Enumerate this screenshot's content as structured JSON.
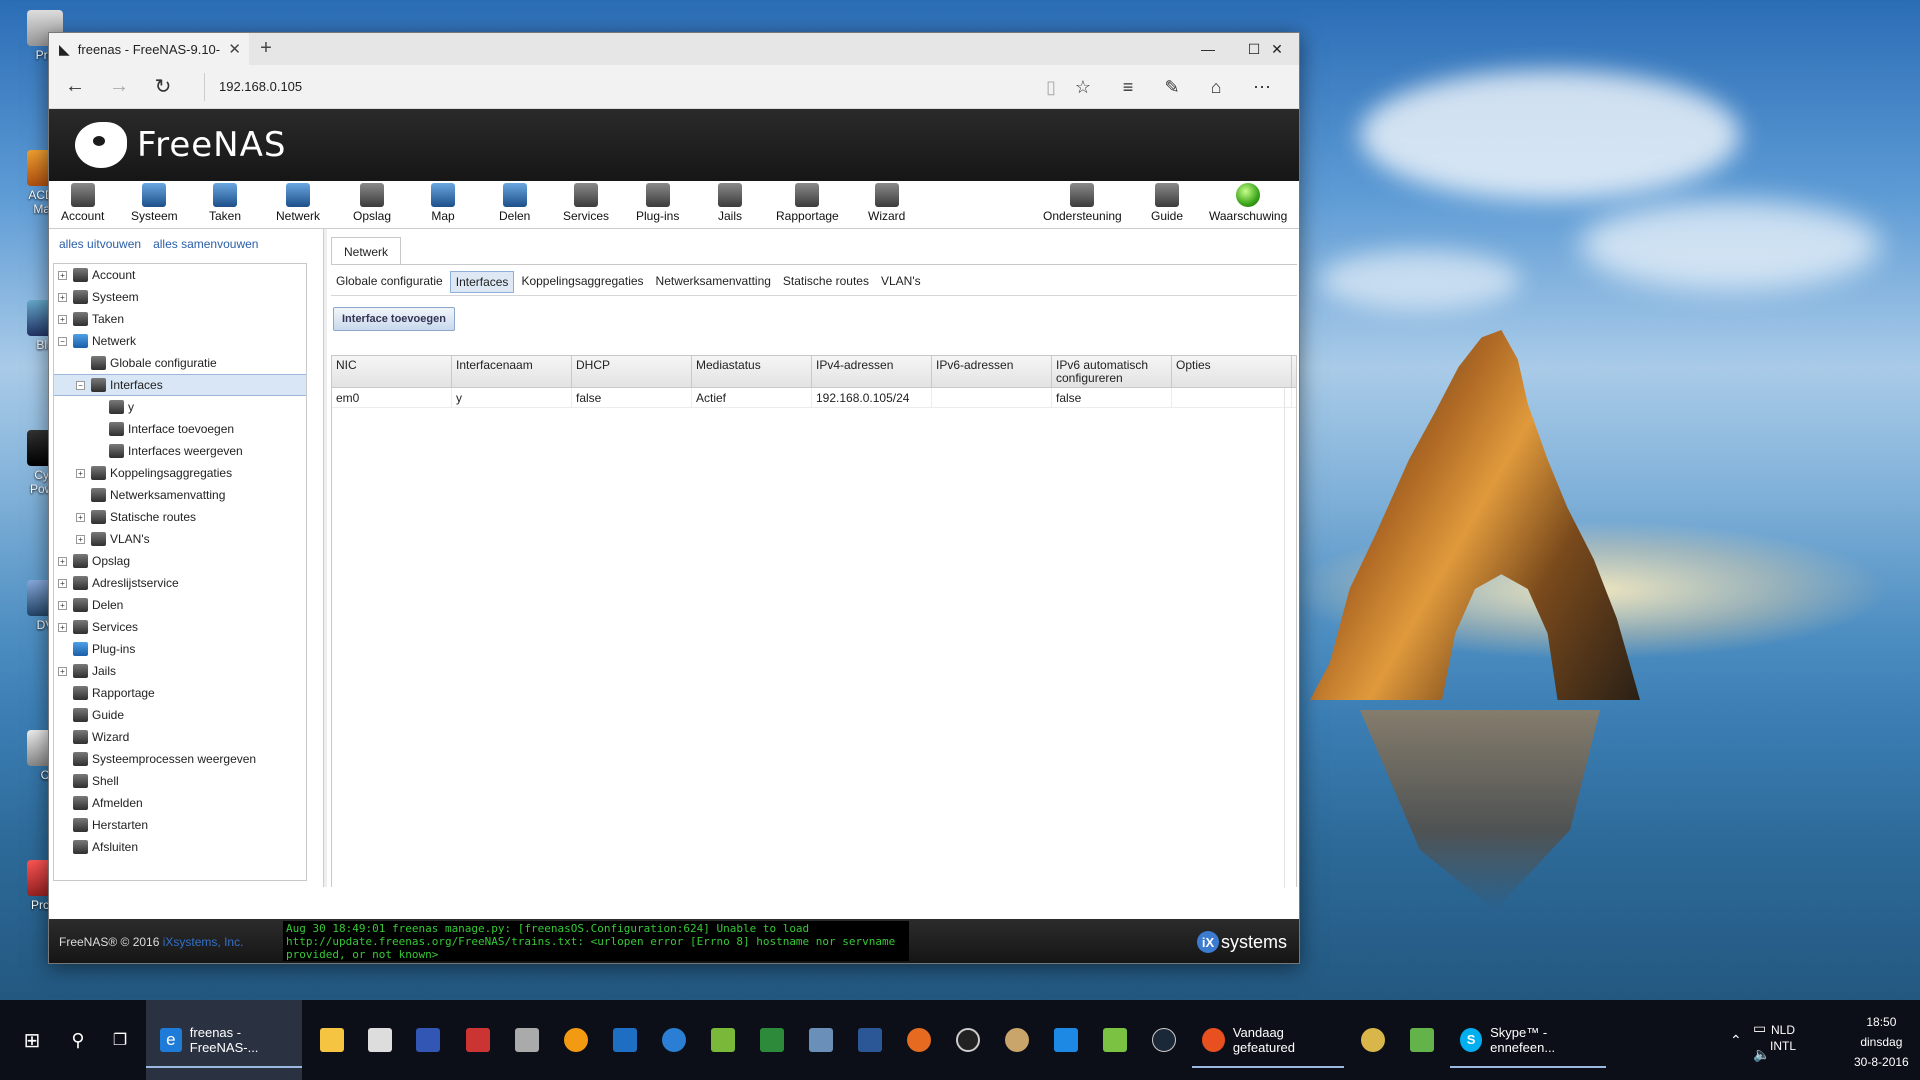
{
  "desktop": {
    "icons": [
      "Pru",
      "ACDS Man",
      "Blu",
      "Cyb Powe",
      "DV",
      "C",
      "Proje"
    ]
  },
  "browser": {
    "tab_title": "freenas - FreeNAS-9.10-",
    "tab_close": "✕",
    "new_tab": "+",
    "url": "192.168.0.105",
    "window_controls": {
      "minimize": "—",
      "maximize": "☐",
      "close": "✕"
    },
    "nav": {
      "back": "←",
      "forward": "→",
      "refresh": "↻"
    },
    "toolbar_icons": [
      "reading-view",
      "favorite",
      "hub",
      "web-note",
      "share",
      "more"
    ]
  },
  "freenas": {
    "logo_text": "FreeNAS",
    "toolbar": [
      {
        "label": "Account"
      },
      {
        "label": "Systeem"
      },
      {
        "label": "Taken"
      },
      {
        "label": "Netwerk"
      },
      {
        "label": "Opslag"
      },
      {
        "label": "Map"
      },
      {
        "label": "Delen"
      },
      {
        "label": "Services"
      },
      {
        "label": "Plug-ins"
      },
      {
        "label": "Jails"
      },
      {
        "label": "Rapportage"
      },
      {
        "label": "Wizard"
      },
      {
        "label": "Ondersteuning"
      },
      {
        "label": "Guide"
      },
      {
        "label": "Waarschuwing"
      }
    ],
    "left": {
      "expand_all": "alles uitvouwen",
      "collapse_all": "alles samenvouwen",
      "tree": [
        {
          "label": "Account",
          "exp": "+"
        },
        {
          "label": "Systeem",
          "exp": "+"
        },
        {
          "label": "Taken",
          "exp": "+"
        },
        {
          "label": "Netwerk",
          "exp": "−"
        },
        {
          "label": "Globale configuratie",
          "exp": ""
        },
        {
          "label": "Interfaces",
          "exp": "−"
        },
        {
          "label": "y",
          "exp": ""
        },
        {
          "label": "Interface toevoegen",
          "exp": ""
        },
        {
          "label": "Interfaces weergeven",
          "exp": ""
        },
        {
          "label": "Koppelingsaggregaties",
          "exp": "+"
        },
        {
          "label": "Netwerksamenvatting",
          "exp": ""
        },
        {
          "label": "Statische routes",
          "exp": "+"
        },
        {
          "label": "VLAN's",
          "exp": "+"
        },
        {
          "label": "Opslag",
          "exp": "+"
        },
        {
          "label": "Adreslijstservice",
          "exp": "+"
        },
        {
          "label": "Delen",
          "exp": "+"
        },
        {
          "label": "Services",
          "exp": "+"
        },
        {
          "label": "Plug-ins",
          "exp": ""
        },
        {
          "label": "Jails",
          "exp": "+"
        },
        {
          "label": "Rapportage",
          "exp": ""
        },
        {
          "label": "Guide",
          "exp": ""
        },
        {
          "label": "Wizard",
          "exp": ""
        },
        {
          "label": "Systeemprocessen weergeven",
          "exp": ""
        },
        {
          "label": "Shell",
          "exp": ""
        },
        {
          "label": "Afmelden",
          "exp": ""
        },
        {
          "label": "Herstarten",
          "exp": ""
        },
        {
          "label": "Afsluiten",
          "exp": ""
        }
      ]
    },
    "content": {
      "main_tab": "Netwerk",
      "subtabs": [
        "Globale configuratie",
        "Interfaces",
        "Koppelingsaggregaties",
        "Netwerksamenvatting",
        "Statische routes",
        "VLAN's"
      ],
      "active_subtab": "Interfaces",
      "add_button": "Interface toevoegen",
      "columns": [
        "NIC",
        "Interfacenaam",
        "DHCP",
        "Mediastatus",
        "IPv4-adressen",
        "IPv6-adressen",
        "IPv6 automatisch configureren",
        "Opties"
      ],
      "rows": [
        [
          "em0",
          "y",
          "false",
          "Actief",
          "192.168.0.105/24",
          "",
          "false",
          ""
        ]
      ]
    },
    "footer": {
      "copyright": "FreeNAS® © 2016",
      "company": "iXsystems, Inc.",
      "console": "Aug 30 18:49:01 freenas manage.py: [freenasOS.Configuration:624] Unable to load http://update.freenas.org/FreeNAS/trains.txt: <urlopen error [Errno 8] hostname nor servname provided, or not known>",
      "ix_badge": "iX",
      "ix_text": "systems"
    }
  },
  "taskbar": {
    "edge_task": "freenas - FreeNAS-...",
    "vandaag": "Vandaag gefeatured",
    "skype": "Skype™ - ennefeen...",
    "lang_top": "NLD",
    "lang_bottom": "INTL",
    "time": "18:50",
    "day": "dinsdag",
    "date": "30-8-2016"
  },
  "colors": {
    "accent": "#2a5ea8",
    "console_text": "#37c837",
    "selection": "#d8e6f5"
  }
}
